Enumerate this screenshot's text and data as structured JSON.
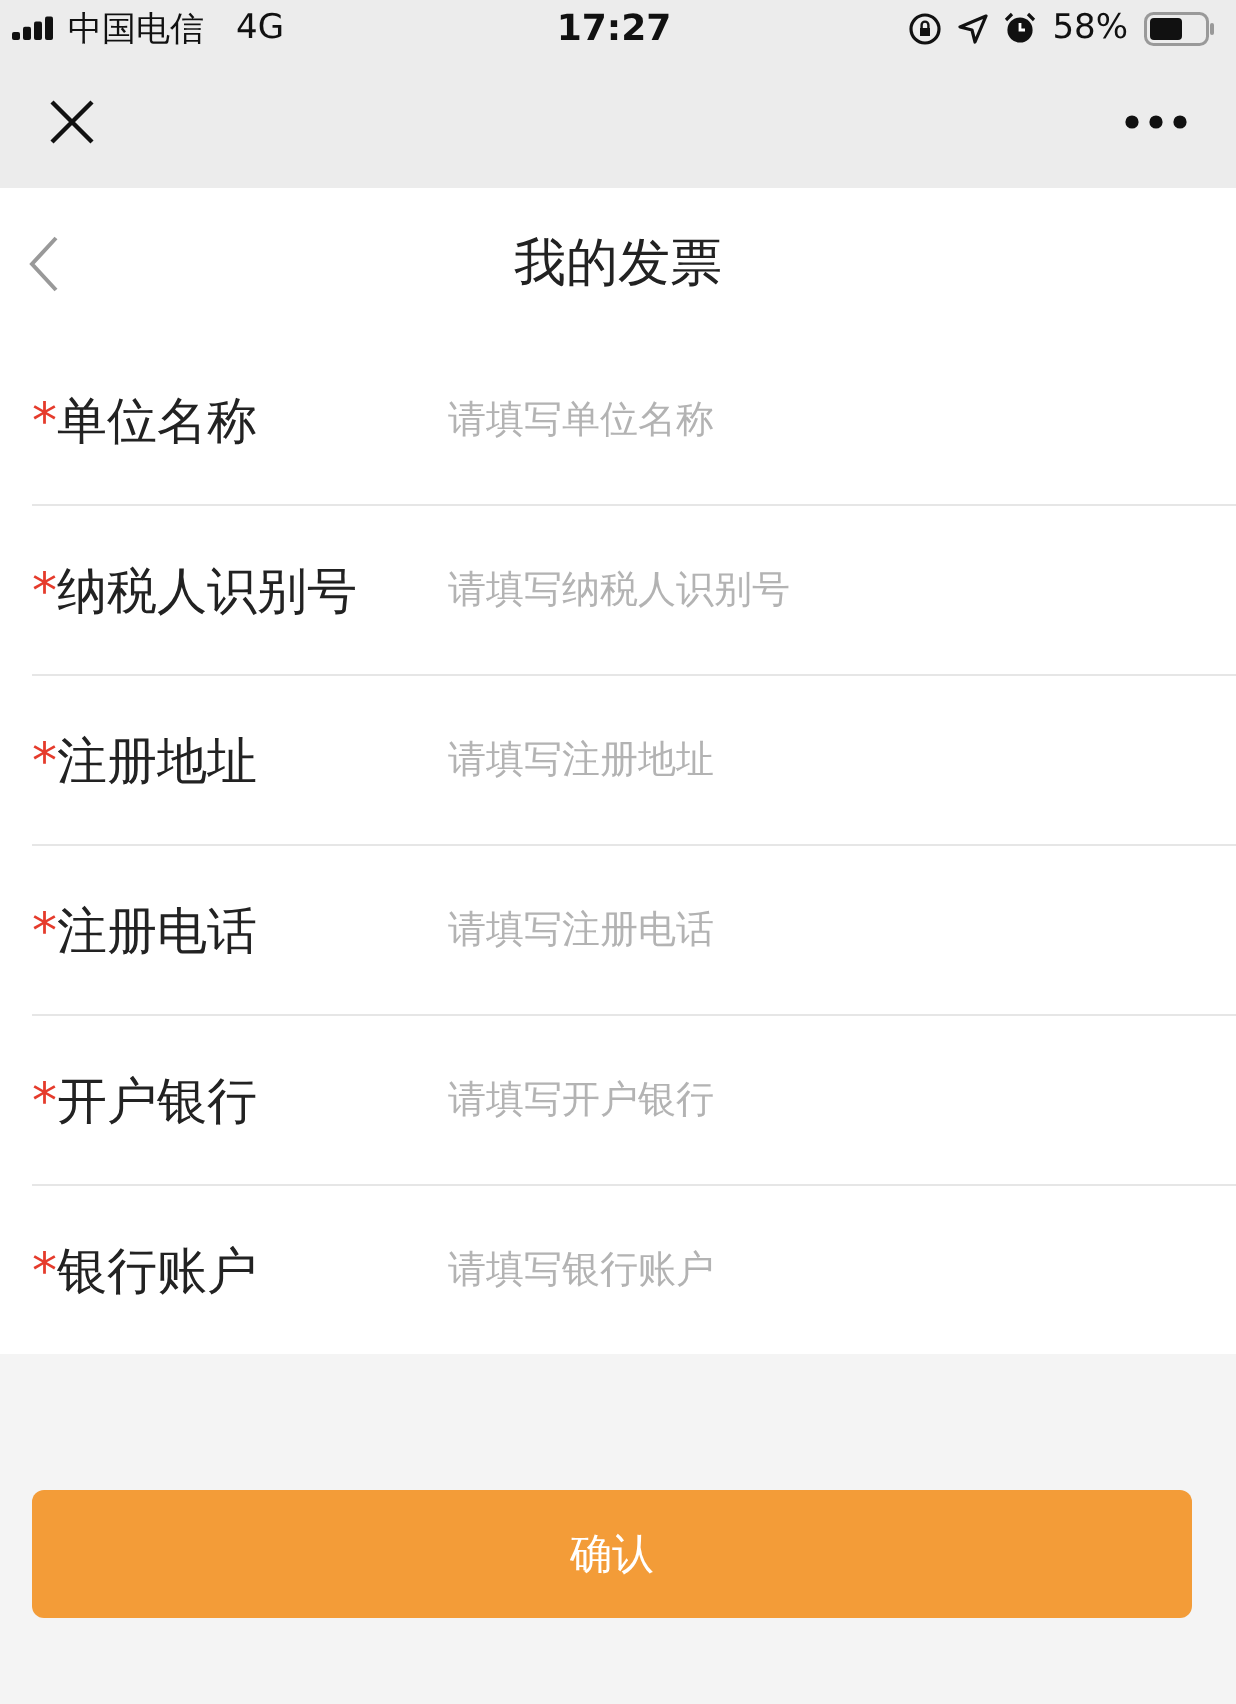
{
  "status_bar": {
    "carrier": "中国电信",
    "network": "4G",
    "time": "17:27",
    "battery": "58%"
  },
  "title": "我的发票",
  "fields": [
    {
      "mark": "*",
      "label": "单位名称",
      "placeholder": "请填写单位名称"
    },
    {
      "mark": "*",
      "label": "纳税人识别号",
      "placeholder": "请填写纳税人识别号"
    },
    {
      "mark": "*",
      "label": "注册地址",
      "placeholder": "请填写注册地址"
    },
    {
      "mark": "*",
      "label": "注册电话",
      "placeholder": "请填写注册电话"
    },
    {
      "mark": "*",
      "label": "开户银行",
      "placeholder": "请填写开户银行"
    },
    {
      "mark": "*",
      "label": "银行账户",
      "placeholder": "请填写银行账户"
    }
  ],
  "confirm_button": "确认"
}
